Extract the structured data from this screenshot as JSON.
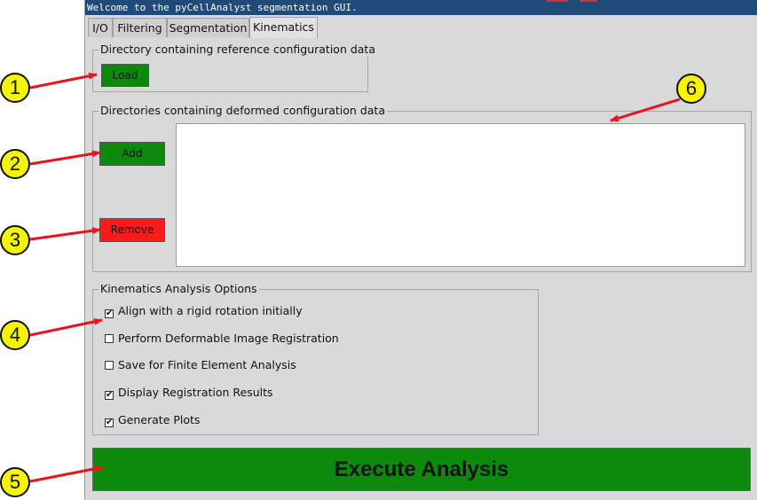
{
  "status_text": "Welcome to the pyCellAnalyst segmentation GUI.",
  "tabs": [
    {
      "label": "I/O"
    },
    {
      "label": "Filtering"
    },
    {
      "label": "Segmentation"
    },
    {
      "label": "Kinematics"
    }
  ],
  "active_tab": "Kinematics",
  "reference": {
    "title": "Directory containing reference configuration data",
    "load_label": "Load"
  },
  "deformed": {
    "title": "Directories containing deformed configuration data",
    "add_label": "Add",
    "remove_label": "Remove",
    "items": []
  },
  "options": {
    "title": "Kinematics Analysis Options",
    "items": [
      {
        "label": "Align with a rigid rotation initially",
        "checked": true
      },
      {
        "label": "Perform Deformable Image Registration",
        "checked": false
      },
      {
        "label": "Save for Finite Element Analysis",
        "checked": false
      },
      {
        "label": "Display Registration Results",
        "checked": true
      },
      {
        "label": "Generate Plots",
        "checked": true
      }
    ]
  },
  "execute_label": "Execute Analysis",
  "callouts": [
    "1",
    "2",
    "3",
    "4",
    "5",
    "6"
  ],
  "colors": {
    "button_green": "#0b8a0b",
    "button_red": "#ff1a1a",
    "callout_fill": "#f5f500",
    "arrow_red": "#e8141e"
  }
}
